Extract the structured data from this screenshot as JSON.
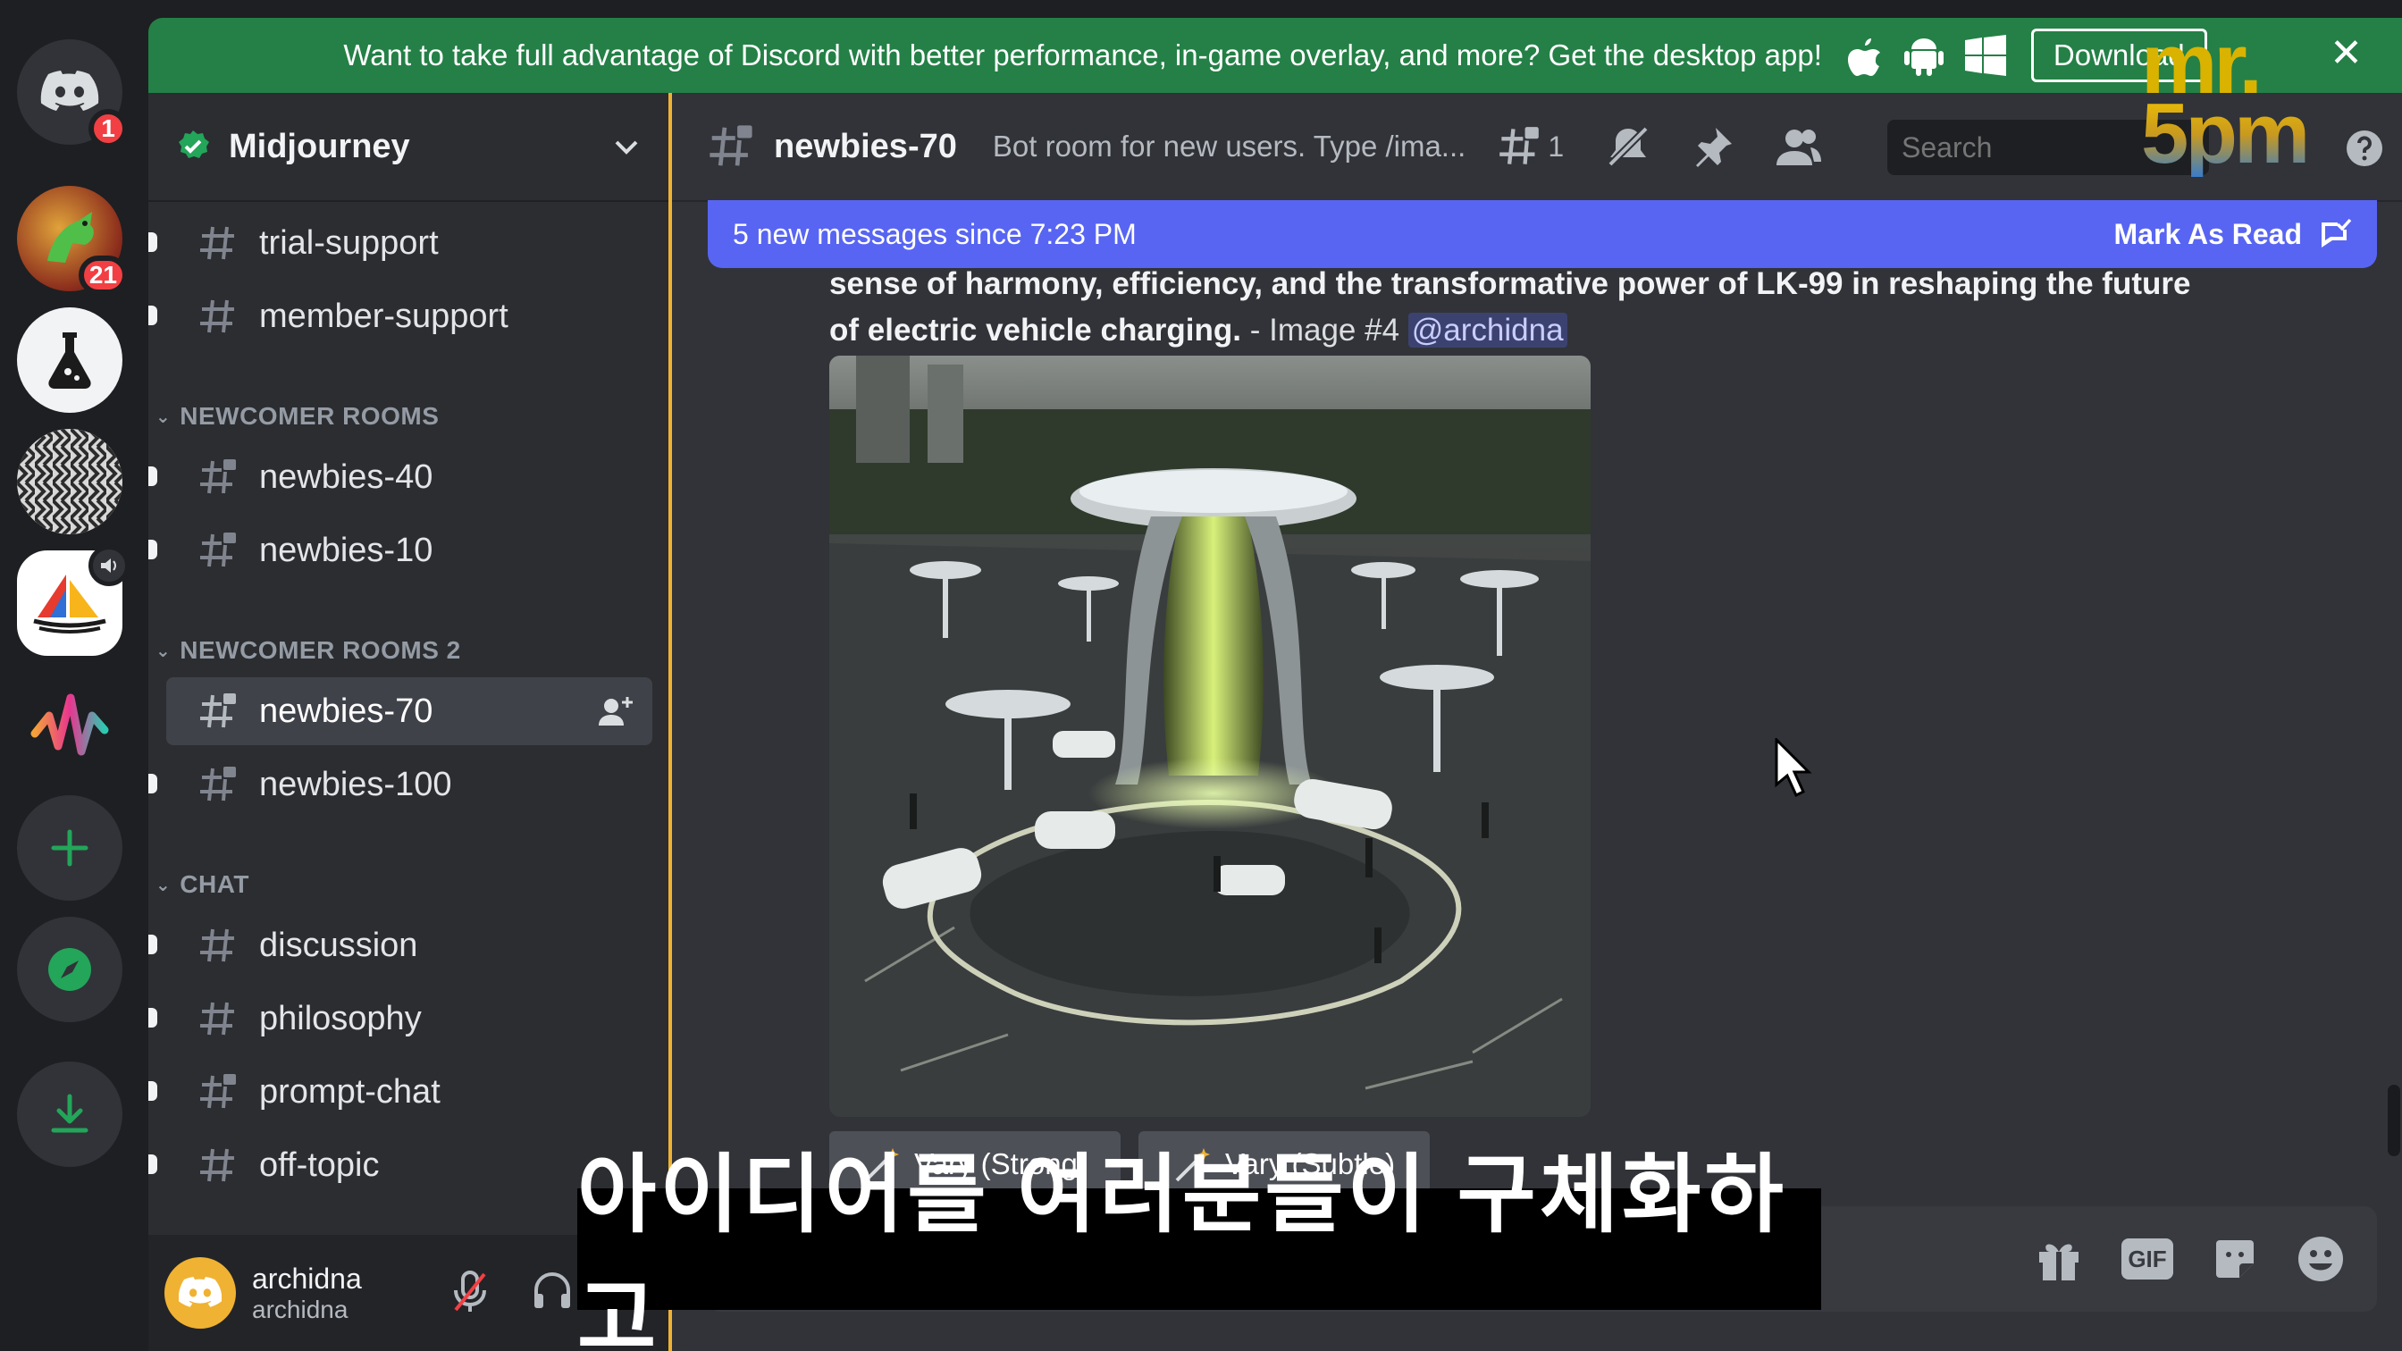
{
  "banner": {
    "text": "Want to take full advantage of Discord with better performance, in-game overlay, and more? Get the desktop app!",
    "download_label": "Download",
    "os_icons": [
      "apple-icon",
      "android-icon",
      "windows-icon"
    ],
    "close": "✕"
  },
  "watermark": {
    "line1": "mr.",
    "line2": "5pm"
  },
  "rail": {
    "servers": [
      {
        "name": "discord-home",
        "badge": "1"
      },
      {
        "name": "server-horse",
        "badge": "21"
      },
      {
        "name": "server-flask",
        "badge": ""
      },
      {
        "name": "server-pattern",
        "badge": ""
      },
      {
        "name": "server-midjourney",
        "badge": ""
      },
      {
        "name": "server-wave",
        "badge": ""
      }
    ]
  },
  "server": {
    "name": "Midjourney"
  },
  "channels": {
    "trial_support": "trial-support",
    "member_support": "member-support",
    "cat_newcomer": "NEWCOMER ROOMS",
    "newbies_40": "newbies-40",
    "newbies_10": "newbies-10",
    "cat_newcomer2": "NEWCOMER ROOMS 2",
    "newbies_70": "newbies-70",
    "newbies_100": "newbies-100",
    "cat_chat": "CHAT",
    "discussion": "discussion",
    "philosophy": "philosophy",
    "prompt_chat": "prompt-chat",
    "off_topic": "off-topic"
  },
  "user": {
    "name": "archidna",
    "tag": "archidna"
  },
  "chat": {
    "channel": "newbies-70",
    "topic": "Bot room for new users. Type /ima...",
    "thread_count": "1",
    "search_placeholder": "Search",
    "new_messages": "5 new messages since 7:23 PM",
    "mark_read": "Mark As Read",
    "message_bold_1": "sense of harmony, efficiency, and the transformative power of LK-99 in reshaping the future",
    "message_bold_2": "of electric vehicle charging.",
    "message_suffix": " - Image #4 ",
    "mention": "@archidna",
    "vary_strong": "Vary (Strong)",
    "vary_subtle": "Vary (Subtle)",
    "composer_icons": [
      "gift-icon",
      "gif-icon",
      "sticker-icon",
      "emoji-icon"
    ],
    "gif_label": "GIF"
  },
  "subtitle": "아이디어를 여러분들이 구체화하고",
  "colors": {
    "banner": "#248046",
    "blurple": "#5865f2",
    "sidebar": "#2b2d31",
    "main": "#313338",
    "accent_line": "#f0b232",
    "badge": "#f23f43"
  }
}
